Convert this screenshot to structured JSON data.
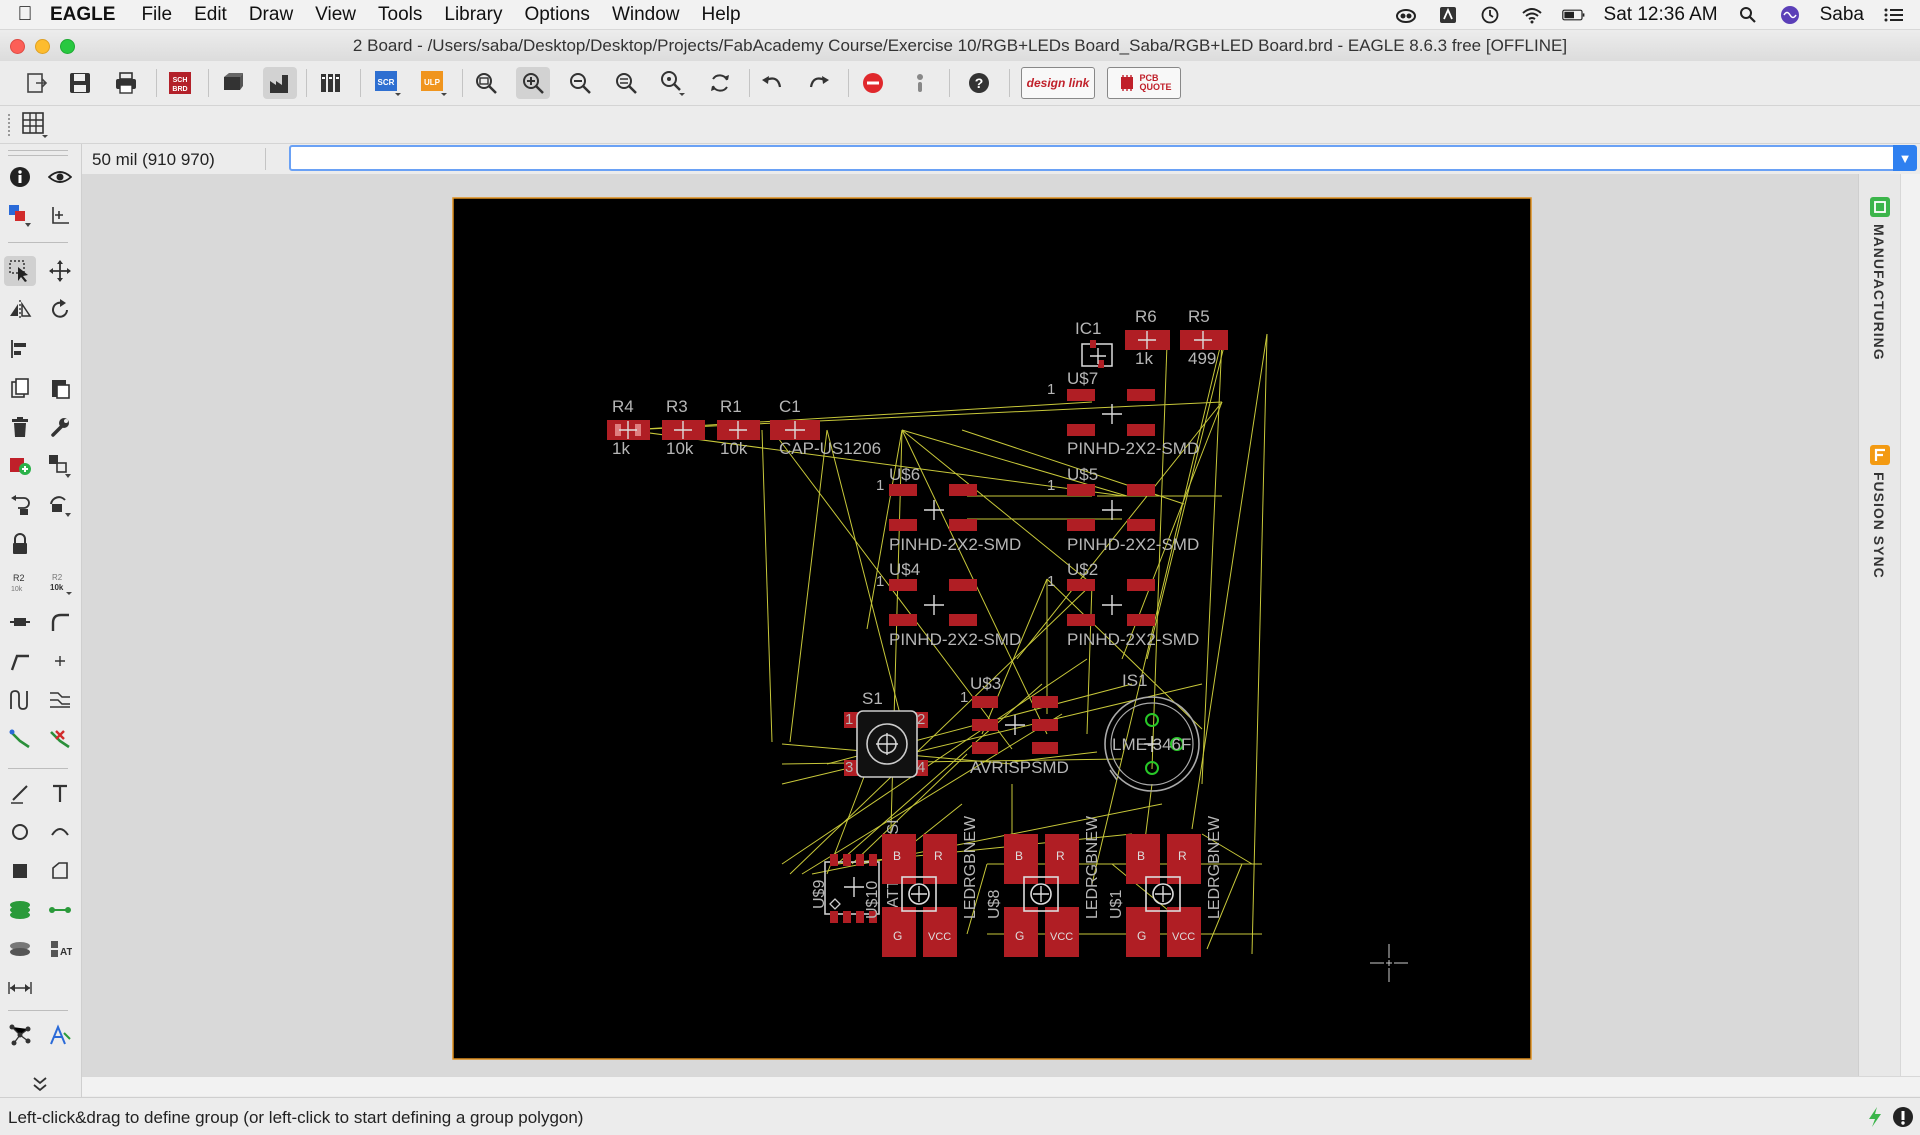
{
  "menubar": {
    "app_name": "EAGLE",
    "items": [
      "File",
      "Edit",
      "Draw",
      "View",
      "Tools",
      "Library",
      "Options",
      "Window",
      "Help"
    ],
    "clock": "Sat 12:36 AM",
    "user": "Saba"
  },
  "window": {
    "title": "2 Board - /Users/saba/Desktop/Desktop/Projects/FabAcademy Course/Exercise 10/RGB+LEDs Board_Saba/RGB+LED Board.brd - EAGLE 8.6.3 free [OFFLINE]"
  },
  "toolbar": {
    "sch_brd_label": "SCH BRD",
    "scr_label": "SCR",
    "ulp_label": "ULP",
    "designlink_label": "design link",
    "pcbquote_label": "PCB QUOTE"
  },
  "cmdbar": {
    "coordinate": "50 mil (910 970)",
    "command_value": ""
  },
  "rightpanel": {
    "manufacturing_label": "MANUFACTURING",
    "fusion_label": "FUSION SYNC"
  },
  "status": {
    "text": "Left-click&drag to define group (or left-click to start defining a group polygon)"
  },
  "colors": {
    "board_bg": "#000000",
    "board_outline": "#e08f1e",
    "pad_red": "#b01e24",
    "airwire_yellow": "#c8c83a",
    "silk_gray": "#b6b6b6",
    "via_green": "#28c828"
  },
  "board": {
    "components": [
      {
        "name": "R4",
        "value": "1k"
      },
      {
        "name": "R3",
        "value": "10k"
      },
      {
        "name": "R1",
        "value": "10k"
      },
      {
        "name": "C1",
        "value": "CAP-US1206"
      },
      {
        "name": "IC1",
        "value": ""
      },
      {
        "name": "R6",
        "value": "1k"
      },
      {
        "name": "R5",
        "value": "499"
      },
      {
        "name": "U$7",
        "value": "PINHD-2X2-SMD"
      },
      {
        "name": "U$6",
        "value": "PINHD-2X2-SMD"
      },
      {
        "name": "U$5",
        "value": "PINHD-2X2-SMD"
      },
      {
        "name": "U$4",
        "value": "PINHD-2X2-SMD"
      },
      {
        "name": "U$2",
        "value": "PINHD-2X2-SMD"
      },
      {
        "name": "U$3",
        "value": "AVRISPSMD"
      },
      {
        "name": "S1",
        "value": ""
      },
      {
        "name": "IS1",
        "value": "LME-346F"
      },
      {
        "name": "U$9",
        "value": "ATTINY45SI"
      },
      {
        "name": "U$10",
        "value": "LEDRGBNEW"
      },
      {
        "name": "U$8",
        "value": "LEDRGBNEW"
      },
      {
        "name": "U$1",
        "value": "LEDRGBNEW"
      }
    ],
    "pin_one_label": "1",
    "switch_pins": [
      "1",
      "2",
      "3",
      "4"
    ],
    "led_pad_labels": [
      "B",
      "R",
      "G",
      "VCC"
    ]
  }
}
